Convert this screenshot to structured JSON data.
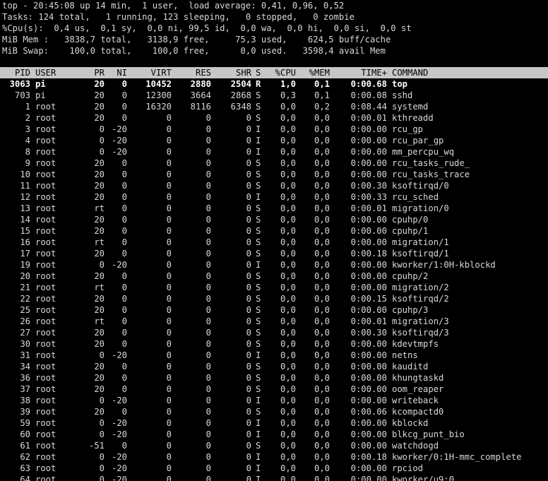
{
  "summary": [
    "top - 20:45:08 up 14 min,  1 user,  load average: 0,41, 0,96, 0,52",
    "Tasks: 124 total,   1 running, 123 sleeping,   0 stopped,   0 zombie",
    "%Cpu(s):  0,4 us,  0,1 sy,  0,0 ni, 99,5 id,  0,0 wa,  0,0 hi,  0,0 si,  0,0 st",
    "MiB Mem :   3838,7 total,   3138,9 free,     75,3 used,    624,5 buff/cache",
    "MiB Swap:    100,0 total,    100,0 free,      0,0 used.   3598,4 avail Mem"
  ],
  "columns": [
    "PID",
    "USER",
    "PR",
    "NI",
    "VIRT",
    "RES",
    "SHR",
    "S",
    "%CPU",
    "%MEM",
    "TIME+",
    "COMMAND"
  ],
  "processes": [
    [
      "3063",
      "pi",
      "20",
      "0",
      "10452",
      "2880",
      "2504",
      "R",
      "1,0",
      "0,1",
      "0:00.68",
      "top"
    ],
    [
      "703",
      "pi",
      "20",
      "0",
      "12300",
      "3664",
      "2868",
      "S",
      "0,3",
      "0,1",
      "0:00.08",
      "sshd"
    ],
    [
      "1",
      "root",
      "20",
      "0",
      "16320",
      "8116",
      "6348",
      "S",
      "0,0",
      "0,2",
      "0:08.44",
      "systemd"
    ],
    [
      "2",
      "root",
      "20",
      "0",
      "0",
      "0",
      "0",
      "S",
      "0,0",
      "0,0",
      "0:00.01",
      "kthreadd"
    ],
    [
      "3",
      "root",
      "0",
      "-20",
      "0",
      "0",
      "0",
      "I",
      "0,0",
      "0,0",
      "0:00.00",
      "rcu_gp"
    ],
    [
      "4",
      "root",
      "0",
      "-20",
      "0",
      "0",
      "0",
      "I",
      "0,0",
      "0,0",
      "0:00.00",
      "rcu_par_gp"
    ],
    [
      "8",
      "root",
      "0",
      "-20",
      "0",
      "0",
      "0",
      "I",
      "0,0",
      "0,0",
      "0:00.00",
      "mm_percpu_wq"
    ],
    [
      "9",
      "root",
      "20",
      "0",
      "0",
      "0",
      "0",
      "S",
      "0,0",
      "0,0",
      "0:00.00",
      "rcu_tasks_rude_"
    ],
    [
      "10",
      "root",
      "20",
      "0",
      "0",
      "0",
      "0",
      "S",
      "0,0",
      "0,0",
      "0:00.00",
      "rcu_tasks_trace"
    ],
    [
      "11",
      "root",
      "20",
      "0",
      "0",
      "0",
      "0",
      "S",
      "0,0",
      "0,0",
      "0:00.30",
      "ksoftirqd/0"
    ],
    [
      "12",
      "root",
      "20",
      "0",
      "0",
      "0",
      "0",
      "I",
      "0,0",
      "0,0",
      "0:00.33",
      "rcu_sched"
    ],
    [
      "13",
      "root",
      "rt",
      "0",
      "0",
      "0",
      "0",
      "S",
      "0,0",
      "0,0",
      "0:00.01",
      "migration/0"
    ],
    [
      "14",
      "root",
      "20",
      "0",
      "0",
      "0",
      "0",
      "S",
      "0,0",
      "0,0",
      "0:00.00",
      "cpuhp/0"
    ],
    [
      "15",
      "root",
      "20",
      "0",
      "0",
      "0",
      "0",
      "S",
      "0,0",
      "0,0",
      "0:00.00",
      "cpuhp/1"
    ],
    [
      "16",
      "root",
      "rt",
      "0",
      "0",
      "0",
      "0",
      "S",
      "0,0",
      "0,0",
      "0:00.00",
      "migration/1"
    ],
    [
      "17",
      "root",
      "20",
      "0",
      "0",
      "0",
      "0",
      "S",
      "0,0",
      "0,0",
      "0:00.18",
      "ksoftirqd/1"
    ],
    [
      "19",
      "root",
      "0",
      "-20",
      "0",
      "0",
      "0",
      "I",
      "0,0",
      "0,0",
      "0:00.00",
      "kworker/1:0H-kblockd"
    ],
    [
      "20",
      "root",
      "20",
      "0",
      "0",
      "0",
      "0",
      "S",
      "0,0",
      "0,0",
      "0:00.00",
      "cpuhp/2"
    ],
    [
      "21",
      "root",
      "rt",
      "0",
      "0",
      "0",
      "0",
      "S",
      "0,0",
      "0,0",
      "0:00.00",
      "migration/2"
    ],
    [
      "22",
      "root",
      "20",
      "0",
      "0",
      "0",
      "0",
      "S",
      "0,0",
      "0,0",
      "0:00.15",
      "ksoftirqd/2"
    ],
    [
      "25",
      "root",
      "20",
      "0",
      "0",
      "0",
      "0",
      "S",
      "0,0",
      "0,0",
      "0:00.00",
      "cpuhp/3"
    ],
    [
      "26",
      "root",
      "rt",
      "0",
      "0",
      "0",
      "0",
      "S",
      "0,0",
      "0,0",
      "0:00.01",
      "migration/3"
    ],
    [
      "27",
      "root",
      "20",
      "0",
      "0",
      "0",
      "0",
      "S",
      "0,0",
      "0,0",
      "0:00.30",
      "ksoftirqd/3"
    ],
    [
      "30",
      "root",
      "20",
      "0",
      "0",
      "0",
      "0",
      "S",
      "0,0",
      "0,0",
      "0:00.00",
      "kdevtmpfs"
    ],
    [
      "31",
      "root",
      "0",
      "-20",
      "0",
      "0",
      "0",
      "I",
      "0,0",
      "0,0",
      "0:00.00",
      "netns"
    ],
    [
      "34",
      "root",
      "20",
      "0",
      "0",
      "0",
      "0",
      "S",
      "0,0",
      "0,0",
      "0:00.00",
      "kauditd"
    ],
    [
      "36",
      "root",
      "20",
      "0",
      "0",
      "0",
      "0",
      "S",
      "0,0",
      "0,0",
      "0:00.00",
      "khungtaskd"
    ],
    [
      "37",
      "root",
      "20",
      "0",
      "0",
      "0",
      "0",
      "S",
      "0,0",
      "0,0",
      "0:00.00",
      "oom_reaper"
    ],
    [
      "38",
      "root",
      "0",
      "-20",
      "0",
      "0",
      "0",
      "I",
      "0,0",
      "0,0",
      "0:00.00",
      "writeback"
    ],
    [
      "39",
      "root",
      "20",
      "0",
      "0",
      "0",
      "0",
      "S",
      "0,0",
      "0,0",
      "0:00.06",
      "kcompactd0"
    ],
    [
      "59",
      "root",
      "0",
      "-20",
      "0",
      "0",
      "0",
      "I",
      "0,0",
      "0,0",
      "0:00.00",
      "kblockd"
    ],
    [
      "60",
      "root",
      "0",
      "-20",
      "0",
      "0",
      "0",
      "I",
      "0,0",
      "0,0",
      "0:00.00",
      "blkcg_punt_bio"
    ],
    [
      "61",
      "root",
      "-51",
      "0",
      "0",
      "0",
      "0",
      "S",
      "0,0",
      "0,0",
      "0:00.00",
      "watchdogd"
    ],
    [
      "62",
      "root",
      "0",
      "-20",
      "0",
      "0",
      "0",
      "I",
      "0,0",
      "0,0",
      "0:00.18",
      "kworker/0:1H-mmc_complete"
    ],
    [
      "63",
      "root",
      "0",
      "-20",
      "0",
      "0",
      "0",
      "I",
      "0,0",
      "0,0",
      "0:00.00",
      "rpciod"
    ],
    [
      "64",
      "root",
      "0",
      "-20",
      "0",
      "0",
      "0",
      "I",
      "0,0",
      "0,0",
      "0:00.00",
      "kworker/u9:0"
    ]
  ],
  "colors": {
    "background": "#000000",
    "text": "#d8d8d8",
    "header_bar": "#c7c7c7",
    "header_text": "#000000",
    "top_row_text": "#ffffff"
  }
}
